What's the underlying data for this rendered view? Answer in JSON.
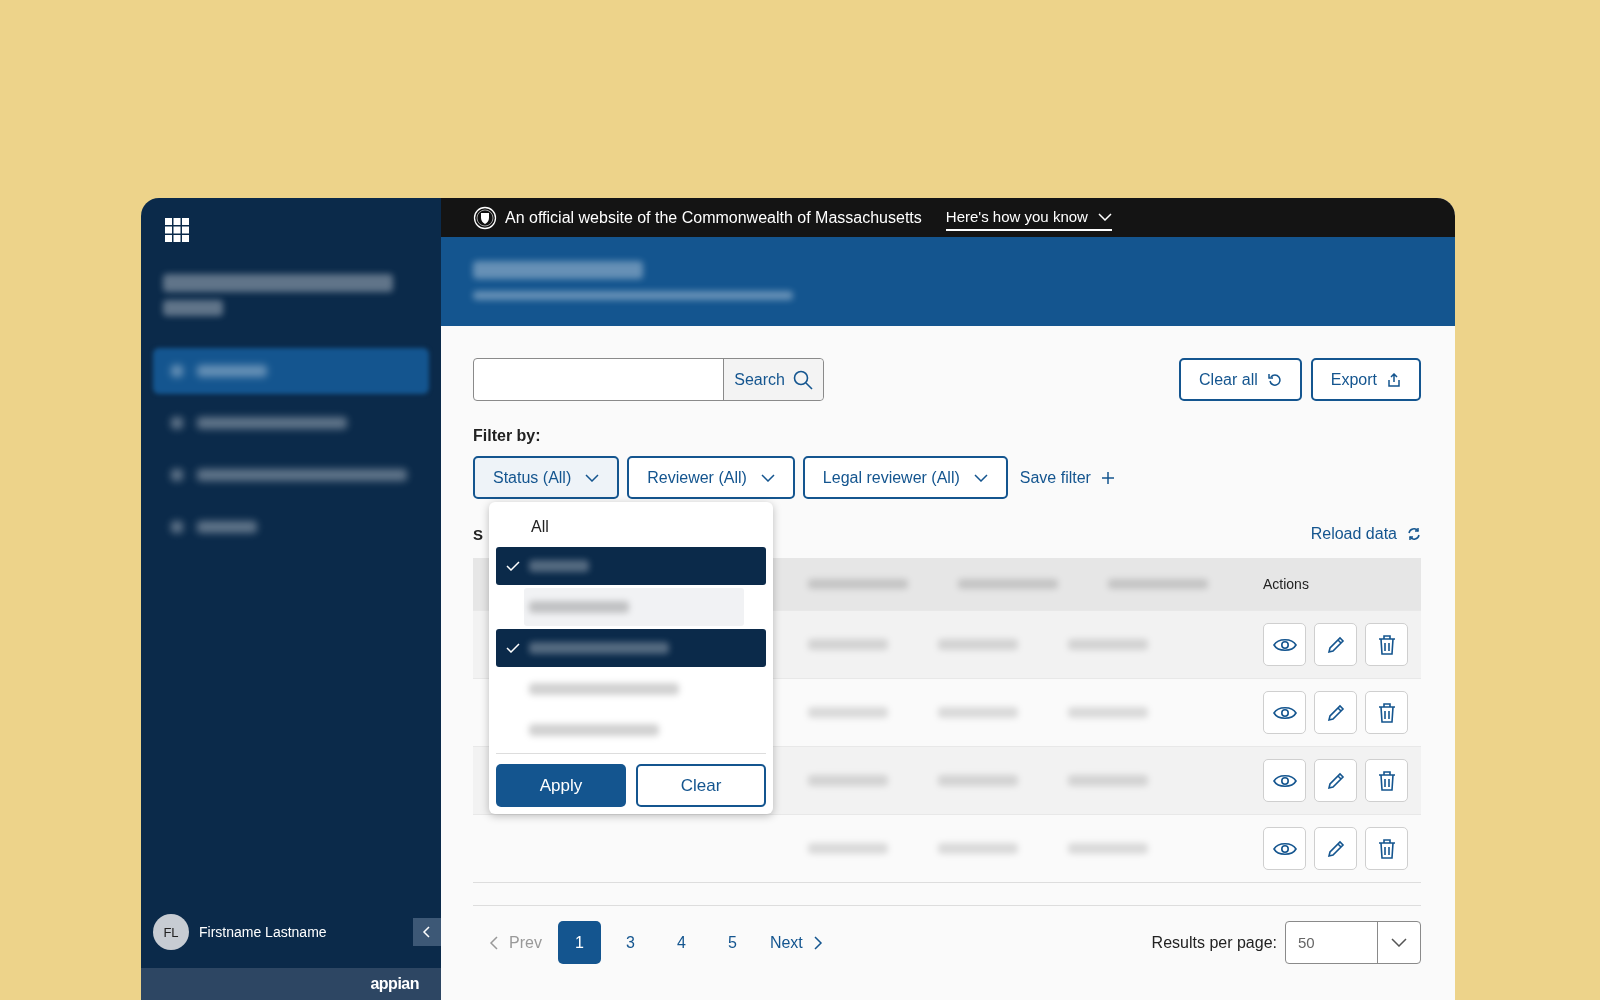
{
  "official_banner": {
    "text": "An official website of the Commonwealth of Massachusetts",
    "link": "Here's how you know"
  },
  "sidebar": {
    "items": [
      {
        "selected": true
      },
      {
        "selected": false
      },
      {
        "selected": false
      },
      {
        "selected": false
      }
    ],
    "user": {
      "initials": "FL",
      "name": "Firstname Lastname"
    },
    "brand": "appian"
  },
  "search": {
    "button": "Search"
  },
  "actions": [
    {
      "label": "Clear all",
      "kind": "reset"
    },
    {
      "label": "Export",
      "kind": "export"
    }
  ],
  "filter_label": "Filter by:",
  "filters": [
    {
      "label": "Status (All)",
      "expanded": true
    },
    {
      "label": "Reviewer (All)",
      "expanded": false
    },
    {
      "label": "Legal reviewer (All)",
      "expanded": false
    }
  ],
  "save_filter": "Save filter",
  "dropdown": {
    "all": "All",
    "options": [
      {
        "selected": true,
        "hovered": false
      },
      {
        "selected": false,
        "hovered": true
      },
      {
        "selected": true,
        "hovered": false
      },
      {
        "selected": false,
        "hovered": false
      },
      {
        "selected": false,
        "hovered": false
      }
    ],
    "apply": "Apply",
    "clear": "Clear"
  },
  "section_initial": "S",
  "reload": "Reload data",
  "table": {
    "actions_heading": "Actions",
    "rows": [
      {
        "actions": [
          {
            "kind": "view"
          },
          {
            "kind": "edit"
          },
          {
            "kind": "delete"
          }
        ]
      },
      {
        "actions": [
          {
            "kind": "view"
          },
          {
            "kind": "edit"
          },
          {
            "kind": "delete"
          }
        ]
      },
      {
        "actions": [
          {
            "kind": "view"
          },
          {
            "kind": "edit"
          },
          {
            "kind": "delete"
          }
        ]
      },
      {
        "actions": [
          {
            "kind": "view"
          },
          {
            "kind": "edit"
          },
          {
            "kind": "delete"
          }
        ]
      }
    ]
  },
  "pagination": {
    "prev": "Prev",
    "prev_disabled": true,
    "pages": [
      {
        "label": "1",
        "selected": true
      },
      {
        "label": "3",
        "selected": false
      },
      {
        "label": "4",
        "selected": false
      },
      {
        "label": "5",
        "selected": false
      }
    ],
    "next": "Next",
    "results_label": "Results per page:",
    "results_value": "50"
  }
}
